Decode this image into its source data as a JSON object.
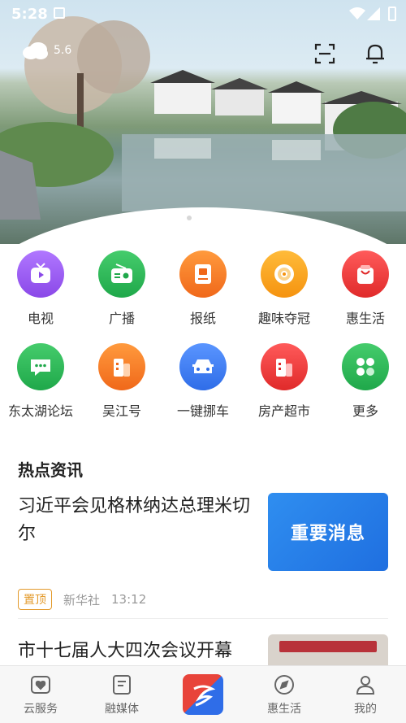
{
  "status_bar": {
    "time": "5:28"
  },
  "weather": {
    "temperature": "5.6",
    "icon": "cloud-icon"
  },
  "banner": {
    "slides": 2,
    "active_slide": 2
  },
  "grid": [
    {
      "label": "电视",
      "icon": "tv-icon",
      "color": "#9b5cf0"
    },
    {
      "label": "广播",
      "icon": "radio-icon",
      "color": "#2fb75a"
    },
    {
      "label": "报纸",
      "icon": "newspaper-icon",
      "color": "#f57a20"
    },
    {
      "label": "趣味夺冠",
      "icon": "disc-icon",
      "color": "#f8a21c"
    },
    {
      "label": "惠生活",
      "icon": "shopping-bag-icon",
      "color": "#ef3b3b"
    },
    {
      "label": "东太湖论坛",
      "icon": "chat-icon",
      "color": "#2fb75a"
    },
    {
      "label": "吴江号",
      "icon": "building-icon",
      "color": "#f57a20"
    },
    {
      "label": "一键挪车",
      "icon": "car-icon",
      "color": "#3d7cf2"
    },
    {
      "label": "房产超市",
      "icon": "house-icon",
      "color": "#ef3b3b"
    },
    {
      "label": "更多",
      "icon": "more-icon",
      "color": "#2fb75a"
    }
  ],
  "section": {
    "title": "热点资讯"
  },
  "news": [
    {
      "title": "习近平会见格林纳达总理米切尔",
      "thumb_text": "重要消息",
      "badge": "置顶",
      "source": "新华社",
      "time": "13:12"
    },
    {
      "title": "市十七届人大四次会议开幕",
      "thumb_text": ""
    }
  ],
  "tabbar": [
    {
      "label": "云服务",
      "icon": "heart-box-icon"
    },
    {
      "label": "融媒体",
      "icon": "document-icon"
    },
    {
      "label": "",
      "icon": "app-logo-icon"
    },
    {
      "label": "惠生活",
      "icon": "compass-icon"
    },
    {
      "label": "我的",
      "icon": "user-icon"
    }
  ]
}
